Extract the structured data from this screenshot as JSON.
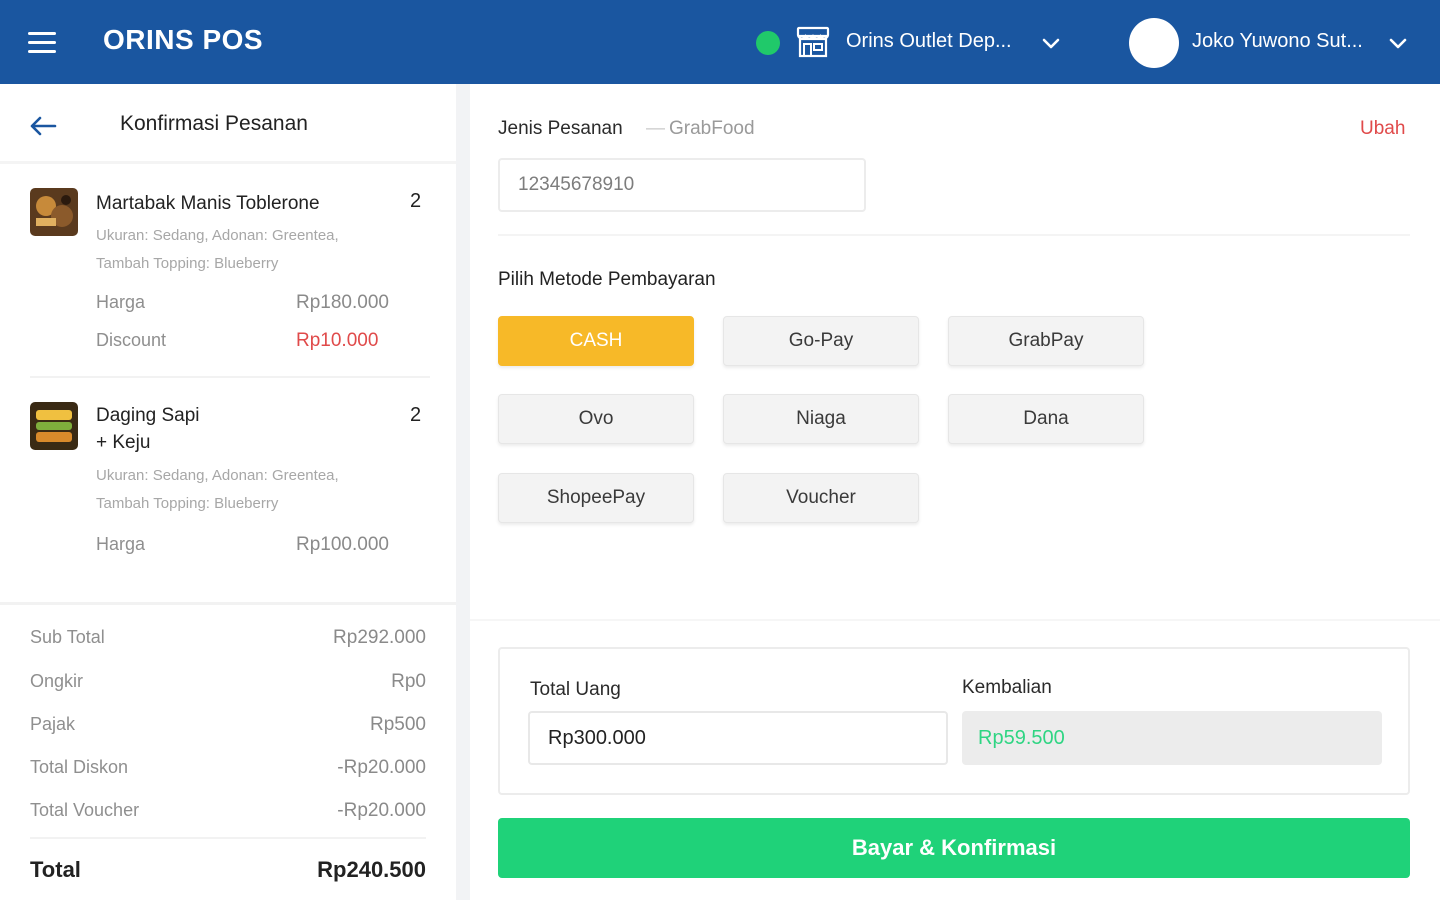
{
  "header": {
    "brand": "ORINS POS",
    "outlet_name": "Orins Outlet Dep...",
    "user_name": "Joko Yuwono Sut...",
    "status_color": "#20c96a",
    "bar_color": "#1a56a0",
    "icons": [
      "menu-icon",
      "store-icon",
      "chevron-down-icon",
      "avatar"
    ]
  },
  "left_panel": {
    "title": "Konfirmasi Pesanan",
    "items": [
      {
        "name": "Martabak Manis Toblerone",
        "qty": "2",
        "desc_line1": "Ukuran: Sedang, Adonan: Greentea,",
        "desc_line2": "Tambah Topping: Blueberry",
        "price_label": "Harga",
        "price": "Rp180.000",
        "discount_label": "Discount",
        "discount": "Rp10.000"
      },
      {
        "name_line1": "Daging Sapi",
        "name_line2": "+ Keju",
        "qty": "2",
        "desc_line1": "Ukuran: Sedang, Adonan: Greentea,",
        "desc_line2": "Tambah Topping: Blueberry",
        "price_label": "Harga",
        "price": "Rp100.000"
      }
    ],
    "summary": {
      "subtotal_label": "Sub Total",
      "subtotal": "Rp292.000",
      "ongkir_label": "Ongkir",
      "ongkir": "Rp0",
      "pajak_label": "Pajak",
      "pajak": "Rp500",
      "diskon_label": "Total Diskon",
      "diskon": "-Rp20.000",
      "voucher_label": "Total Voucher",
      "voucher": "-Rp20.000",
      "total_label": "Total",
      "total": "Rp240.500"
    }
  },
  "right_panel": {
    "order_type_label": "Jenis Pesanan",
    "order_type_sep": "—",
    "order_type_value": "GrabFood",
    "change_link": "Ubah",
    "order_id": "12345678910",
    "payment_title": "Pilih Metode Pembayaran",
    "payment_methods": [
      "CASH",
      "Go-Pay",
      "GrabPay",
      "Ovo",
      "Niaga",
      "Dana",
      "ShopeePay",
      "Voucher"
    ],
    "selected_method": "CASH",
    "selected_color": "#f7b928",
    "total_uang_label": "Total Uang",
    "total_uang_value": "Rp300.000",
    "kembalian_label": "Kembalian",
    "kembalian_value": "Rp59.500",
    "confirm_label": "Bayar & Konfirmasi",
    "confirm_color": "#1fd279"
  }
}
